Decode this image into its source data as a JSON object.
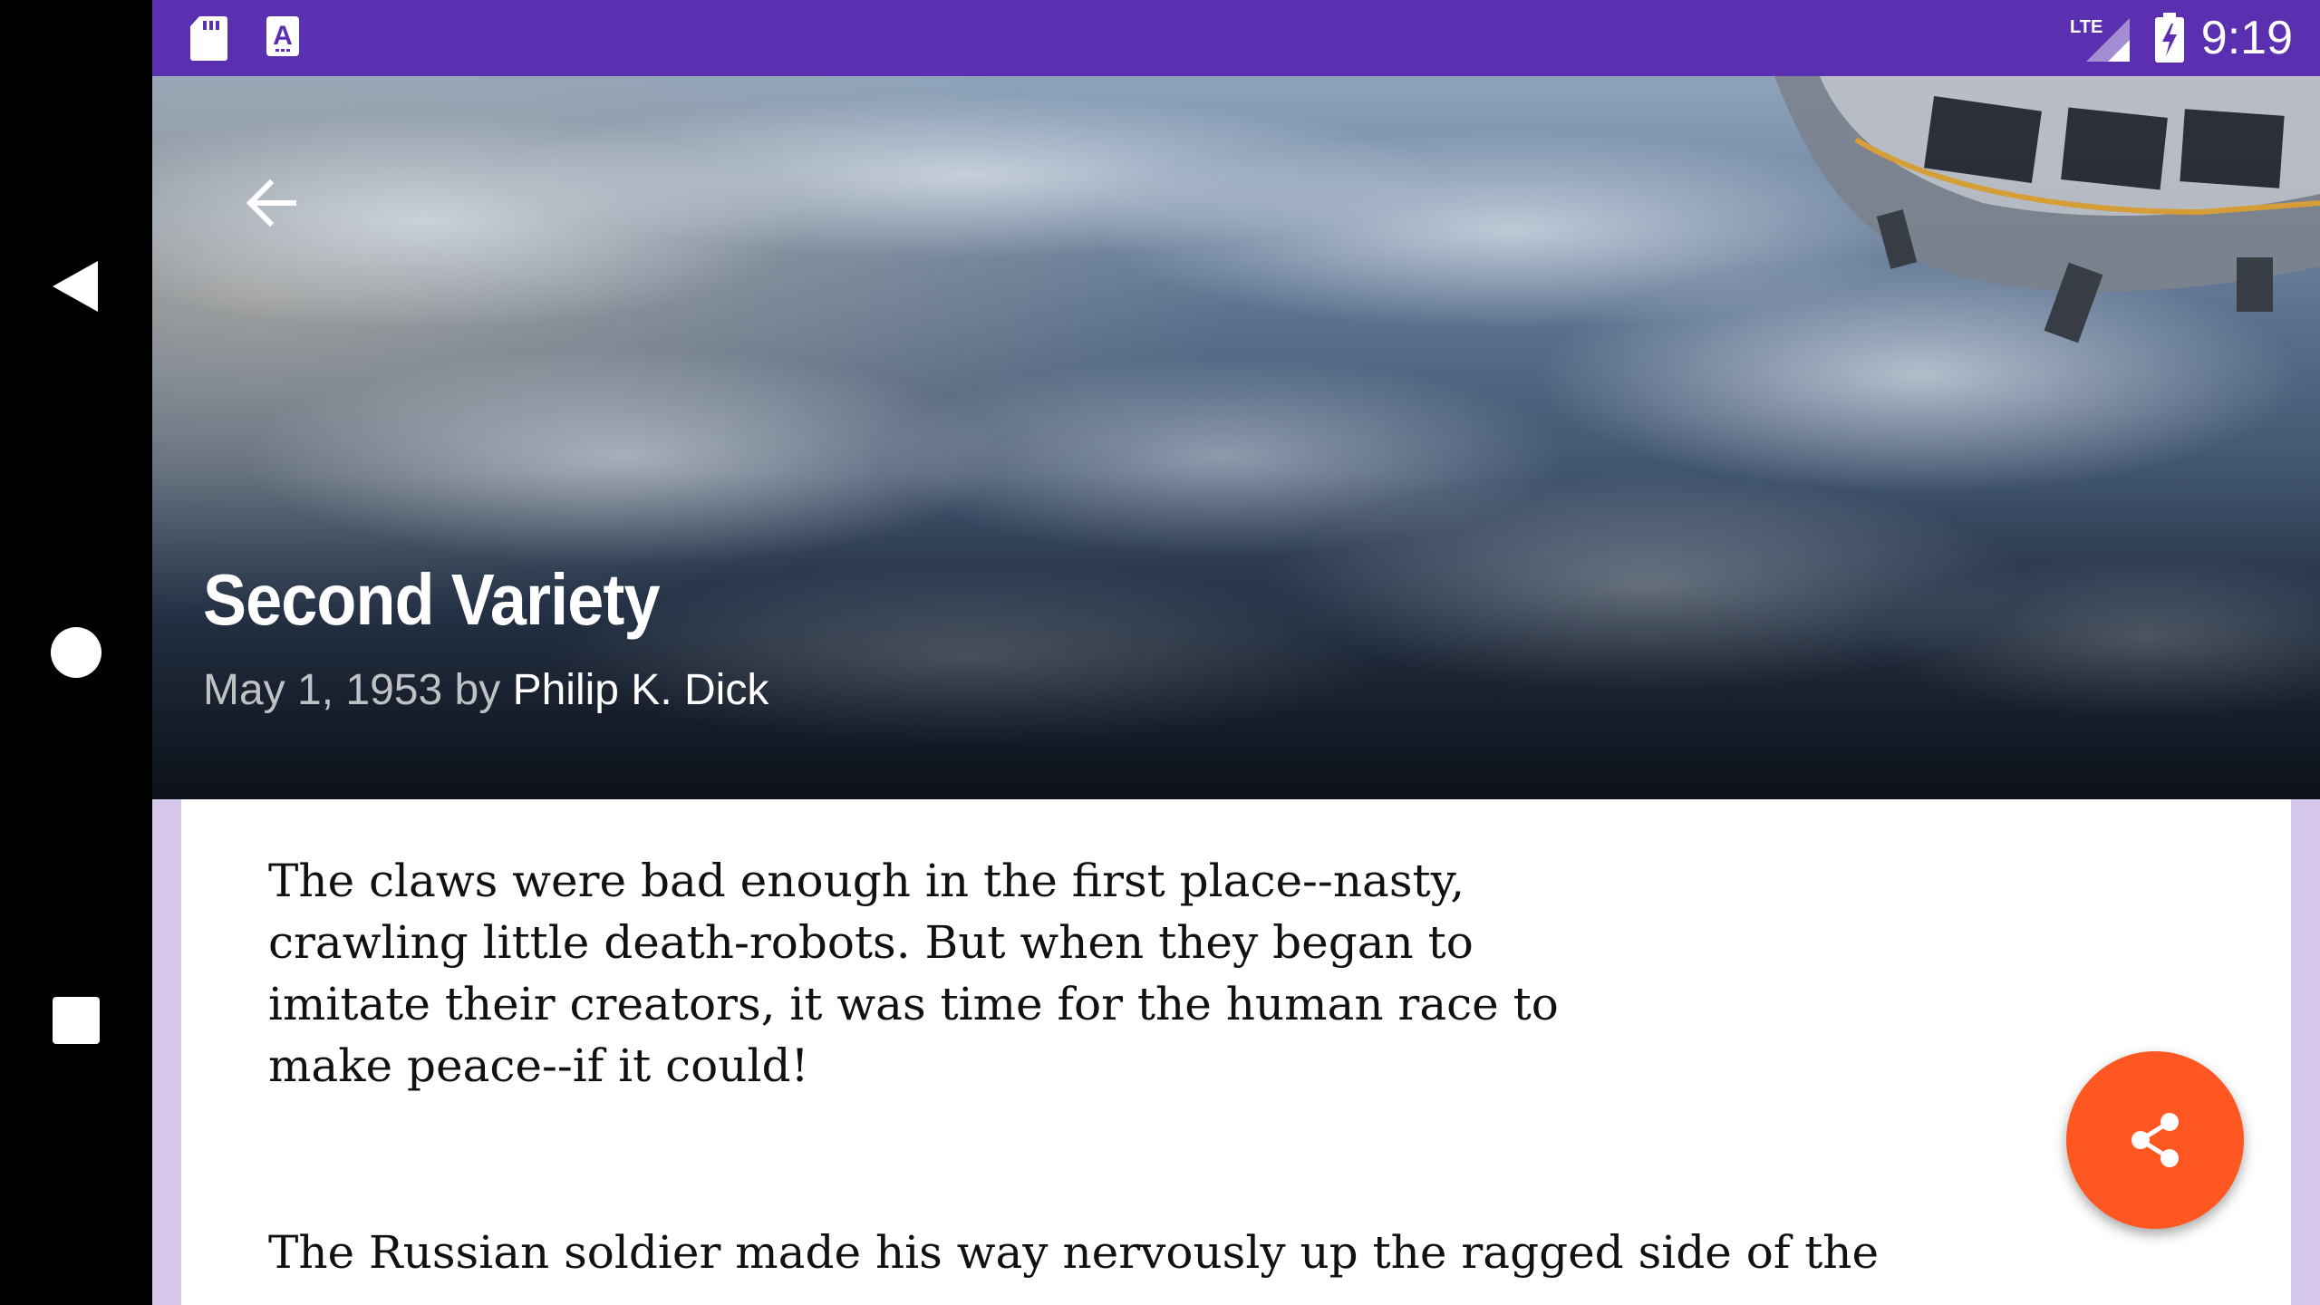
{
  "status_bar": {
    "time": "9:19",
    "network": "LTE",
    "color": "#5a30b0"
  },
  "icons": {
    "sd_card": "sd-card-icon",
    "keyboard_a": "a-icon",
    "signal": "signal-icon",
    "battery": "battery-charging-icon",
    "back": "arrow-left-icon",
    "share": "share-icon",
    "nav_back": "triangle-back-icon",
    "nav_home": "circle-home-icon",
    "nav_recents": "square-recents-icon"
  },
  "article": {
    "title": "Second Variety",
    "date": "May 1, 1953",
    "by": "by",
    "author": "Philip K. Dick",
    "paragraphs": [
      "The claws were bad enough in the first place--nasty, crawling little death-robots. But when they began to imitate their creators, it was time for the human race to make peace--if it could!",
      "The Russian soldier made his way nervously up the ragged side of the"
    ]
  },
  "colors": {
    "fab": "#ff5722",
    "content_border": "#d4c7ea",
    "accent": "#5a30b0"
  }
}
